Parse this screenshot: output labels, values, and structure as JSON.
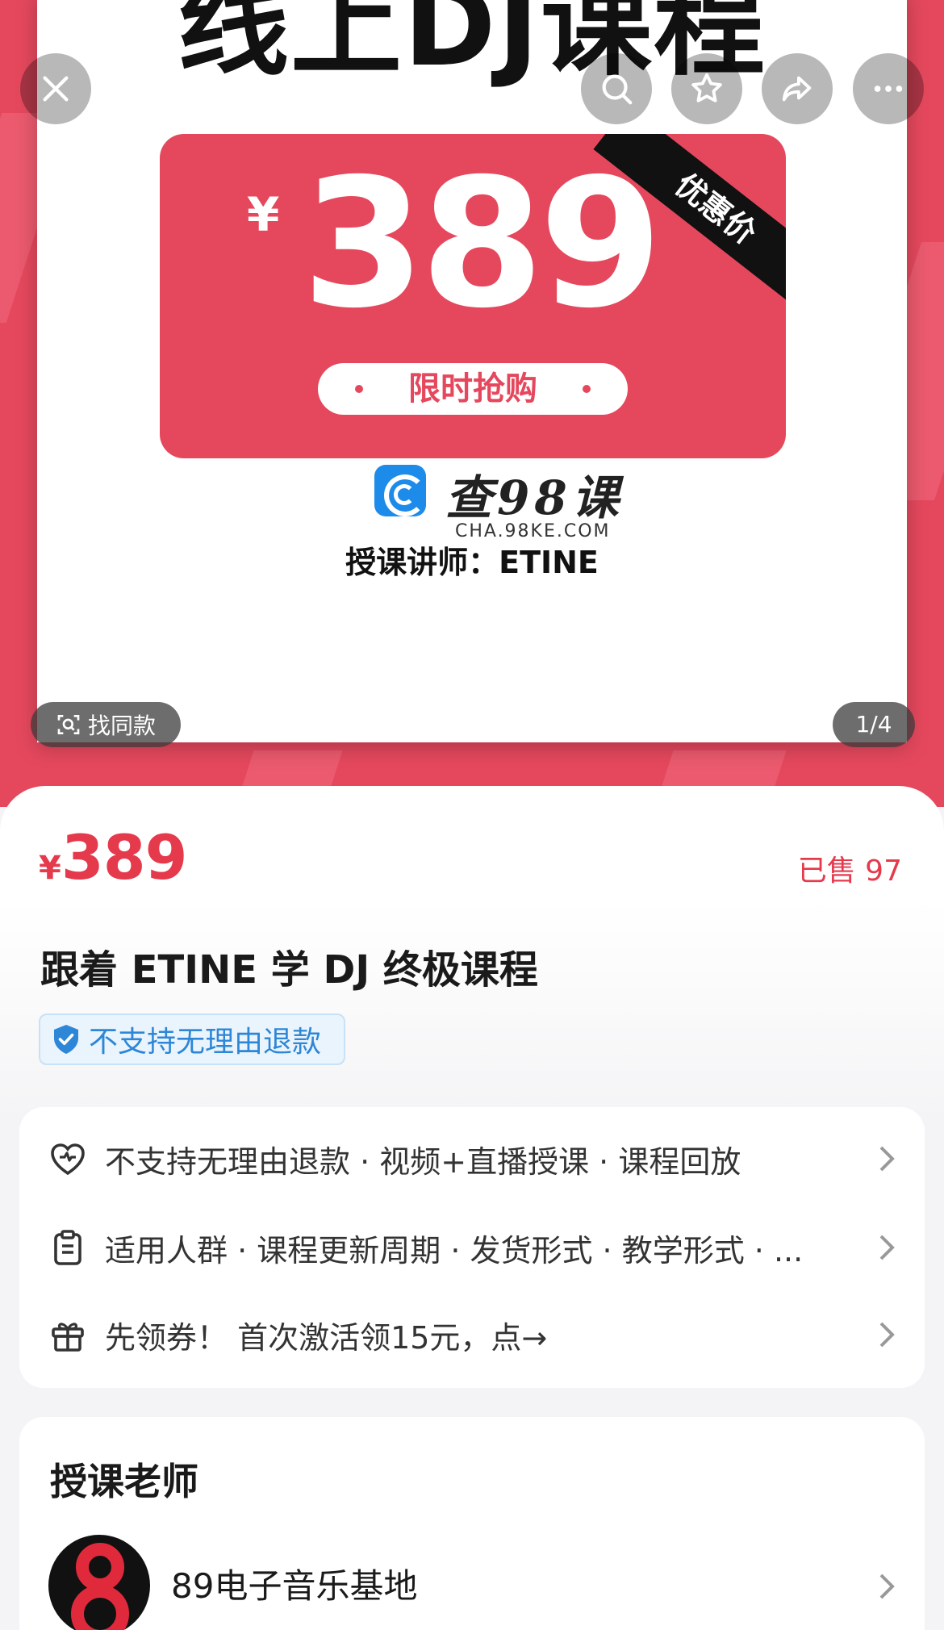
{
  "hero": {
    "heading": "线上DJ课程",
    "currency_symbol": "¥",
    "price": "389",
    "ribbon": "优惠价",
    "limited_label": "限时抢购",
    "brand_name": "查98课",
    "brand_url": "CHA.98KE.COM",
    "instructor_line": "授课讲师：ETINE",
    "find_same_label": "找同款",
    "page_counter": "1/4"
  },
  "top_actions": [
    "close-icon",
    "search-icon",
    "star-icon",
    "share-icon",
    "more-icon"
  ],
  "product": {
    "currency_symbol": "¥",
    "price": "389",
    "sold": "已售 97",
    "title": "跟着 ETINE 学 DJ 终极课程",
    "refund_badge": "不支持无理由退款"
  },
  "info_rows": [
    {
      "icon": "heart-shield-icon",
      "text": "不支持无理由退款 · 视频+直播授课 · 课程回放"
    },
    {
      "icon": "clipboard-icon",
      "text": "适用人群 · 课程更新周期 · 发货形式 · 教学形式 · ..."
    },
    {
      "icon": "gift-icon",
      "text": "先领券！ 首次激活领15元，点→"
    }
  ],
  "teacher": {
    "heading": "授课老师",
    "name": "89电子音乐基地"
  },
  "colors": {
    "brand_red": "#e5485d",
    "price_red": "#e5394c",
    "badge_blue": "#2d86d6"
  }
}
